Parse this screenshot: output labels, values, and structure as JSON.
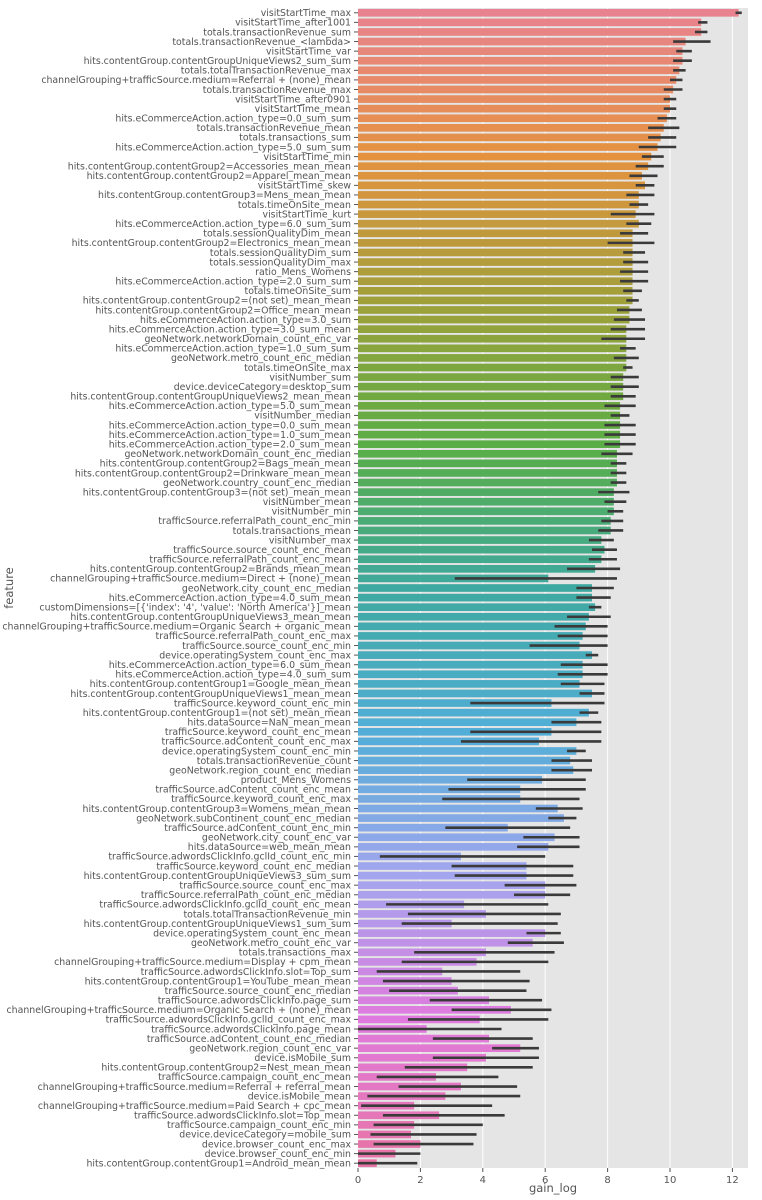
{
  "chart_data": {
    "type": "bar",
    "orientation": "horizontal",
    "xlabel": "gain_log",
    "ylabel": "feature",
    "xlim": [
      0,
      12.5
    ],
    "x_ticks": [
      0,
      2,
      4,
      6,
      8,
      10,
      12
    ],
    "grid": true,
    "background": "#e5e5e5",
    "grid_color": "#ffffff",
    "error_bar_color": "#3a3a3a",
    "palette": [
      "#e8828f",
      "#e5923f",
      "#a0a03a",
      "#5aae45",
      "#3ea9a0",
      "#52aed8",
      "#a3a6ee",
      "#e07ade",
      "#e874a4"
    ],
    "categories": [
      "visitStartTime_max",
      "visitStartTime_after1001",
      "totals.transactionRevenue_sum",
      "totals.transactionRevenue_<lambda>",
      "visitStartTime_var",
      "hits.contentGroup.contentGroupUniqueViews2_sum_sum",
      "totals.totalTransactionRevenue_max",
      "channelGrouping+trafficSource.medium=Referral + (none)_mean",
      "totals.transactionRevenue_max",
      "visitStartTime_after0901",
      "visitStartTime_mean",
      "hits.eCommerceAction.action_type=0.0_sum_sum",
      "totals.transactionRevenue_mean",
      "totals.transactions_sum",
      "hits.eCommerceAction.action_type=5.0_sum_sum",
      "visitStartTime_min",
      "hits.contentGroup.contentGroup2=Accessories_mean_mean",
      "hits.contentGroup.contentGroup2=Apparel_mean_mean",
      "visitStartTime_skew",
      "hits.contentGroup.contentGroup3=Mens_mean_mean",
      "totals.timeOnSite_mean",
      "visitStartTime_kurt",
      "hits.eCommerceAction.action_type=6.0_sum_sum",
      "totals.sessionQualityDim_mean",
      "hits.contentGroup.contentGroup2=Electronics_mean_mean",
      "totals.sessionQualityDim_sum",
      "totals.sessionQualityDim_max",
      "ratio_Mens_Womens",
      "hits.eCommerceAction.action_type=2.0_sum_sum",
      "totals.timeOnSite_sum",
      "hits.contentGroup.contentGroup2=(not set)_mean_mean",
      "hits.contentGroup.contentGroup2=Office_mean_mean",
      "hits.eCommerceAction.action_type=3.0_sum",
      "hits.eCommerceAction.action_type=3.0_sum_mean",
      "geoNetwork.networkDomain_count_enc_var",
      "hits.eCommerceAction.action_type=1.0_sum_sum",
      "geoNetwork.metro_count_enc_median",
      "totals.timeOnSite_max",
      "visitNumber_sum",
      "device.deviceCategory=desktop_sum",
      "hits.contentGroup.contentGroupUniqueViews2_mean_mean",
      "hits.eCommerceAction.action_type=5.0_sum_mean",
      "visitNumber_median",
      "hits.eCommerceAction.action_type=0.0_sum_mean",
      "hits.eCommerceAction.action_type=1.0_sum_mean",
      "hits.eCommerceAction.action_type=2.0_sum_mean",
      "geoNetwork.networkDomain_count_enc_median",
      "hits.contentGroup.contentGroup2=Bags_mean_mean",
      "hits.contentGroup.contentGroup2=Drinkware_mean_mean",
      "geoNetwork.country_count_enc_median",
      "hits.contentGroup.contentGroup3=(not set)_mean_mean",
      "visitNumber_mean",
      "visitNumber_min",
      "trafficSource.referralPath_count_enc_min",
      "totals.transactions_mean",
      "visitNumber_max",
      "trafficSource.source_count_enc_mean",
      "trafficSource.referralPath_count_enc_mean",
      "hits.contentGroup.contentGroup2=Brands_mean_mean",
      "channelGrouping+trafficSource.medium=Direct + (none)_mean",
      "geoNetwork.city_count_enc_median",
      "hits.eCommerceAction.action_type=4.0_sum_mean",
      "customDimensions=[{'index': '4', 'value': 'North America'}]_mean",
      "hits.contentGroup.contentGroupUniqueViews3_mean_mean",
      "channelGrouping+trafficSource.medium=Organic Search + organic_mean",
      "trafficSource.referralPath_count_enc_max",
      "trafficSource.source_count_enc_min",
      "device.operatingSystem_count_enc_max",
      "hits.eCommerceAction.action_type=6.0_sum_mean",
      "hits.eCommerceAction.action_type=4.0_sum_sum",
      "hits.contentGroup.contentGroup1=Google_mean_mean",
      "hits.contentGroup.contentGroupUniqueViews1_mean_mean",
      "trafficSource.keyword_count_enc_min",
      "hits.contentGroup.contentGroup1=(not set)_mean_mean",
      "hits.dataSource=NaN_mean_mean",
      "trafficSource.keyword_count_enc_mean",
      "trafficSource.adContent_count_enc_max",
      "device.operatingSystem_count_enc_min",
      "totals.transactionRevenue_count",
      "geoNetwork.region_count_enc_median",
      "product_Mens_Womens",
      "trafficSource.adContent_count_enc_mean",
      "trafficSource.keyword_count_enc_max",
      "hits.contentGroup.contentGroup3=Womens_mean_mean",
      "geoNetwork.subContinent_count_enc_median",
      "trafficSource.adContent_count_enc_min",
      "geoNetwork.city_count_enc_var",
      "hits.dataSource=web_mean_mean",
      "trafficSource.adwordsClickInfo.gclId_count_enc_min",
      "trafficSource.keyword_count_enc_median",
      "hits.contentGroup.contentGroupUniqueViews3_sum_sum",
      "trafficSource.source_count_enc_max",
      "trafficSource.referralPath_count_enc_median",
      "trafficSource.adwordsClickInfo.gclId_count_enc_mean",
      "totals.totalTransactionRevenue_min",
      "hits.contentGroup.contentGroupUniqueViews1_sum_sum",
      "device.operatingSystem_count_enc_mean",
      "geoNetwork.metro_count_enc_var",
      "totals.transactions_max",
      "channelGrouping+trafficSource.medium=Display + cpm_mean",
      "trafficSource.adwordsClickInfo.slot=Top_sum",
      "hits.contentGroup.contentGroup1=YouTube_mean_mean",
      "trafficSource.source_count_enc_median",
      "trafficSource.adwordsClickInfo.page_sum",
      "channelGrouping+trafficSource.medium=Organic Search + (none)_mean",
      "trafficSource.adwordsClickInfo.gclId_count_enc_max",
      "trafficSource.adwordsClickInfo.page_mean",
      "trafficSource.adContent_count_enc_median",
      "geoNetwork.region_count_enc_var",
      "device.isMobile_sum",
      "hits.contentGroup.contentGroup2=Nest_mean_mean",
      "trafficSource.campaign_count_enc_mean",
      "channelGrouping+trafficSource.medium=Referral + referral_mean",
      "device.isMobile_mean",
      "channelGrouping+trafficSource.medium=Paid Search + cpc_mean",
      "trafficSource.adwordsClickInfo.slot=Top_mean",
      "trafficSource.campaign_count_enc_min",
      "device.deviceCategory=mobile_sum",
      "device.browser_count_enc_max",
      "device.browser_count_enc_min",
      "hits.contentGroup.contentGroup1=Android_mean_mean"
    ],
    "values": [
      12.2,
      11.0,
      11.0,
      10.5,
      10.4,
      10.4,
      10.3,
      10.2,
      10.1,
      10.0,
      10.0,
      9.9,
      9.8,
      9.7,
      9.6,
      9.4,
      9.3,
      9.1,
      9.2,
      9.0,
      9.0,
      8.9,
      9.0,
      8.8,
      8.8,
      8.8,
      8.8,
      8.8,
      8.8,
      8.8,
      8.8,
      8.7,
      8.7,
      8.6,
      8.6,
      8.6,
      8.6,
      8.6,
      8.5,
      8.5,
      8.5,
      8.4,
      8.4,
      8.4,
      8.4,
      8.4,
      8.3,
      8.3,
      8.3,
      8.3,
      8.2,
      8.2,
      8.2,
      8.1,
      8.1,
      7.8,
      7.9,
      7.8,
      7.6,
      6.1,
      7.5,
      7.5,
      7.6,
      7.4,
      7.3,
      7.2,
      7.1,
      7.5,
      7.2,
      7.2,
      7.1,
      7.5,
      6.2,
      7.4,
      7.0,
      6.2,
      5.8,
      7.0,
      6.8,
      6.9,
      5.9,
      5.2,
      5.2,
      6.4,
      6.6,
      4.8,
      6.3,
      6.1,
      3.3,
      5.4,
      5.4,
      6.0,
      6.0,
      3.4,
      4.1,
      3.0,
      6.0,
      5.6,
      4.1,
      3.8,
      2.7,
      3.0,
      3.2,
      4.2,
      4.9,
      3.9,
      2.2,
      4.2,
      5.2,
      4.1,
      3.5,
      2.5,
      3.3,
      2.8,
      1.8,
      2.6,
      1.8,
      1.7,
      2.0,
      1.2,
      0.6
    ],
    "ci": [
      [
        12.1,
        12.3
      ],
      [
        10.9,
        11.2
      ],
      [
        10.8,
        11.2
      ],
      [
        10.1,
        11.3
      ],
      [
        10.2,
        10.7
      ],
      [
        10.1,
        10.7
      ],
      [
        10.1,
        10.5
      ],
      [
        10.0,
        10.4
      ],
      [
        9.8,
        10.4
      ],
      [
        9.8,
        10.2
      ],
      [
        9.8,
        10.2
      ],
      [
        9.6,
        10.2
      ],
      [
        9.3,
        10.3
      ],
      [
        9.3,
        10.2
      ],
      [
        9.0,
        10.2
      ],
      [
        9.1,
        9.8
      ],
      [
        8.9,
        9.8
      ],
      [
        8.7,
        9.6
      ],
      [
        8.9,
        9.5
      ],
      [
        8.6,
        9.5
      ],
      [
        8.7,
        9.3
      ],
      [
        8.1,
        9.5
      ],
      [
        8.6,
        9.4
      ],
      [
        8.4,
        9.3
      ],
      [
        8.0,
        9.5
      ],
      [
        8.5,
        9.2
      ],
      [
        8.5,
        9.3
      ],
      [
        8.4,
        9.3
      ],
      [
        8.4,
        9.3
      ],
      [
        8.5,
        9.1
      ],
      [
        8.6,
        9.0
      ],
      [
        8.3,
        9.1
      ],
      [
        8.2,
        9.2
      ],
      [
        8.1,
        9.2
      ],
      [
        7.8,
        9.2
      ],
      [
        8.4,
        8.9
      ],
      [
        8.2,
        9.0
      ],
      [
        8.5,
        8.8
      ],
      [
        8.1,
        9.0
      ],
      [
        8.1,
        9.0
      ],
      [
        8.1,
        8.9
      ],
      [
        7.9,
        8.9
      ],
      [
        8.1,
        8.7
      ],
      [
        7.9,
        8.9
      ],
      [
        7.9,
        8.9
      ],
      [
        7.9,
        8.9
      ],
      [
        7.8,
        8.8
      ],
      [
        8.1,
        8.6
      ],
      [
        8.1,
        8.6
      ],
      [
        8.1,
        8.6
      ],
      [
        7.7,
        8.7
      ],
      [
        7.9,
        8.6
      ],
      [
        8.0,
        8.5
      ],
      [
        7.8,
        8.5
      ],
      [
        7.7,
        8.5
      ],
      [
        7.4,
        8.2
      ],
      [
        7.5,
        8.3
      ],
      [
        7.4,
        8.3
      ],
      [
        6.7,
        8.4
      ],
      [
        3.1,
        8.3
      ],
      [
        7.0,
        8.2
      ],
      [
        7.0,
        8.1
      ],
      [
        7.4,
        7.8
      ],
      [
        6.7,
        8.1
      ],
      [
        6.3,
        8.0
      ],
      [
        6.4,
        8.0
      ],
      [
        5.5,
        8.0
      ],
      [
        7.3,
        7.7
      ],
      [
        6.5,
        8.0
      ],
      [
        6.4,
        8.0
      ],
      [
        6.5,
        7.9
      ],
      [
        7.1,
        7.9
      ],
      [
        3.6,
        7.9
      ],
      [
        7.1,
        7.7
      ],
      [
        6.2,
        7.8
      ],
      [
        3.6,
        7.8
      ],
      [
        3.3,
        7.8
      ],
      [
        6.7,
        7.3
      ],
      [
        6.2,
        7.5
      ],
      [
        6.2,
        7.5
      ],
      [
        3.5,
        7.3
      ],
      [
        2.9,
        7.3
      ],
      [
        2.7,
        7.1
      ],
      [
        5.7,
        7.2
      ],
      [
        6.1,
        7.0
      ],
      [
        2.8,
        6.8
      ],
      [
        5.3,
        7.1
      ],
      [
        5.1,
        7.1
      ],
      [
        0.7,
        6.0
      ],
      [
        3.0,
        6.9
      ],
      [
        3.1,
        6.9
      ],
      [
        4.7,
        7.0
      ],
      [
        5.0,
        6.8
      ],
      [
        0.9,
        6.1
      ],
      [
        1.6,
        6.5
      ],
      [
        1.4,
        6.4
      ],
      [
        5.4,
        6.5
      ],
      [
        4.8,
        6.6
      ],
      [
        1.8,
        6.3
      ],
      [
        1.4,
        6.1
      ],
      [
        0.6,
        5.2
      ],
      [
        0.8,
        5.5
      ],
      [
        1.0,
        5.4
      ],
      [
        2.3,
        5.9
      ],
      [
        3.0,
        6.2
      ],
      [
        1.6,
        6.1
      ],
      [
        0.0,
        4.6
      ],
      [
        2.4,
        5.6
      ],
      [
        4.3,
        5.8
      ],
      [
        2.4,
        5.8
      ],
      [
        1.5,
        5.6
      ],
      [
        0.6,
        4.5
      ],
      [
        1.3,
        5.1
      ],
      [
        0.3,
        5.2
      ],
      [
        0.1,
        4.3
      ],
      [
        0.8,
        4.7
      ],
      [
        0.5,
        4.0
      ],
      [
        0.4,
        3.8
      ],
      [
        0.5,
        3.7
      ],
      [
        0.0,
        2.0
      ],
      [
        0.0,
        1.9
      ]
    ]
  }
}
